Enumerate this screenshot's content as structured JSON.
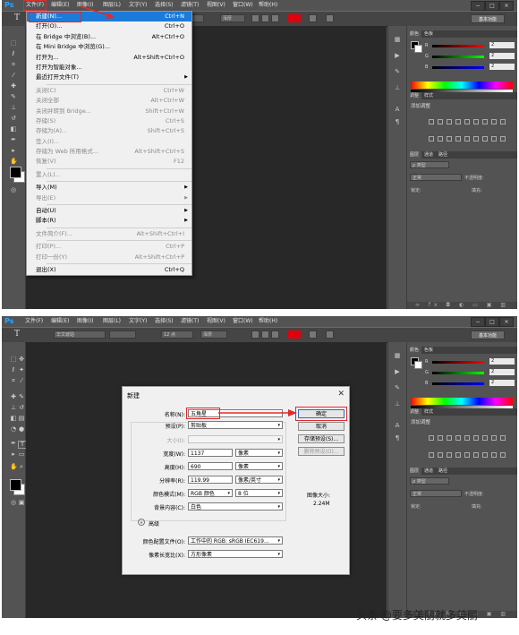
{
  "app": {
    "logo": "Ps"
  },
  "menubar": {
    "items": [
      "文件(F)",
      "编辑(E)",
      "图像(I)",
      "图层(L)",
      "文字(Y)",
      "选择(S)",
      "滤镜(T)",
      "视图(V)",
      "窗口(W)",
      "帮助(H)"
    ],
    "active": "文件(F)"
  },
  "window_buttons": {
    "minimize": "−",
    "maximize": "□",
    "close": "×"
  },
  "optionsbar": {
    "tool_icon": "T",
    "font_family": "宋体",
    "font_family_2": "华文琥珀",
    "font_size": "12 点",
    "antialias": "浑厚",
    "workspace": "基本功能",
    "text_color": "#e3000b"
  },
  "panels": {
    "color_tabs": [
      "颜色",
      "色板"
    ],
    "sliders": [
      {
        "label": "R",
        "value": "2",
        "colors": [
          "#000000",
          "#ff0000"
        ]
      },
      {
        "label": "G",
        "value": "2",
        "colors": [
          "#000000",
          "#00ff00"
        ]
      },
      {
        "label": "B",
        "value": "2",
        "colors": [
          "#000000",
          "#0000ff"
        ]
      }
    ],
    "adjust_tabs": [
      "调整",
      "样式"
    ],
    "adjust_title": "添加调整",
    "layers_tabs": [
      "图层",
      "通道",
      "路径"
    ],
    "layers_kind": "ρ 类型",
    "blend_mode": "正常",
    "opacity_label": "不透明度:",
    "lock_label": "锁定:",
    "fill_label": "填充:",
    "layers_footer": "∞ fx ◘ ◐ ▭ ▣ ▥"
  },
  "file_menu": {
    "items": [
      {
        "label": "新建(N)...",
        "shortcut": "Ctrl+N",
        "highlighted": true
      },
      {
        "label": "打开(O)...",
        "shortcut": "Ctrl+O"
      },
      {
        "label": "在 Bridge 中浏览(B)...",
        "shortcut": "Alt+Ctrl+O"
      },
      {
        "label": "在 Mini Bridge 中浏览(G)...",
        "shortcut": ""
      },
      {
        "label": "打开为...",
        "shortcut": "Alt+Shift+Ctrl+O"
      },
      {
        "label": "打开为智能对象...",
        "shortcut": ""
      },
      {
        "label": "最近打开文件(T)",
        "shortcut": "",
        "submenu": true
      },
      {
        "sep": true
      },
      {
        "label": "关闭(C)",
        "shortcut": "Ctrl+W",
        "disabled": true
      },
      {
        "label": "关闭全部",
        "shortcut": "Alt+Ctrl+W",
        "disabled": true
      },
      {
        "label": "关闭并转到 Bridge...",
        "shortcut": "Shift+Ctrl+W",
        "disabled": true
      },
      {
        "label": "存储(S)",
        "shortcut": "Ctrl+S",
        "disabled": true
      },
      {
        "label": "存储为(A)...",
        "shortcut": "Shift+Ctrl+S",
        "disabled": true
      },
      {
        "label": "签入(I)...",
        "shortcut": "",
        "disabled": true
      },
      {
        "label": "存储为 Web 所用格式...",
        "shortcut": "Alt+Shift+Ctrl+S",
        "disabled": true
      },
      {
        "label": "恢复(V)",
        "shortcut": "F12",
        "disabled": true
      },
      {
        "sep": true
      },
      {
        "label": "置入(L)...",
        "shortcut": "",
        "disabled": true
      },
      {
        "sep": true
      },
      {
        "label": "导入(M)",
        "shortcut": "",
        "submenu": true
      },
      {
        "label": "导出(E)",
        "shortcut": "",
        "submenu": true,
        "disabled": true
      },
      {
        "sep": true
      },
      {
        "label": "自动(U)",
        "shortcut": "",
        "submenu": true
      },
      {
        "label": "脚本(R)",
        "shortcut": "",
        "submenu": true
      },
      {
        "sep": true
      },
      {
        "label": "文件简介(F)...",
        "shortcut": "Alt+Shift+Ctrl+I",
        "disabled": true
      },
      {
        "sep": true
      },
      {
        "label": "打印(P)...",
        "shortcut": "Ctrl+P",
        "disabled": true
      },
      {
        "label": "打印一份(Y)",
        "shortcut": "Alt+Shift+Ctrl+P",
        "disabled": true
      },
      {
        "sep": true
      },
      {
        "label": "退出(X)",
        "shortcut": "Ctrl+Q"
      }
    ]
  },
  "new_dialog": {
    "title": "新建",
    "name_label": "名称(N):",
    "name_value": "五角星",
    "preset_label": "预设(P):",
    "preset_value": "剪贴板",
    "size_label": "大小(I):",
    "width_label": "宽度(W):",
    "width_value": "1137",
    "width_unit": "像素",
    "height_label": "高度(H):",
    "height_value": "690",
    "height_unit": "像素",
    "resolution_label": "分辨率(R):",
    "resolution_value": "119.99",
    "resolution_unit": "像素/英寸",
    "color_mode_label": "颜色模式(M):",
    "color_mode_value": "RGB 颜色",
    "bit_depth": "8 位",
    "background_label": "背景内容(C):",
    "background_value": "白色",
    "advanced_label": "高级",
    "color_profile_label": "颜色配置文件(O):",
    "color_profile_value": "工作中的 RGB: sRGB IEC619...",
    "pixel_aspect_label": "像素长宽比(X):",
    "pixel_aspect_value": "方形像素",
    "ok": "确定",
    "cancel": "取消",
    "save_preset": "存储预设(S)...",
    "delete_preset": "删除预设(D)...",
    "image_size_label": "图像大小:",
    "image_size_value": "2.24M"
  },
  "watermark": "头条 @要多美丽就多美丽"
}
